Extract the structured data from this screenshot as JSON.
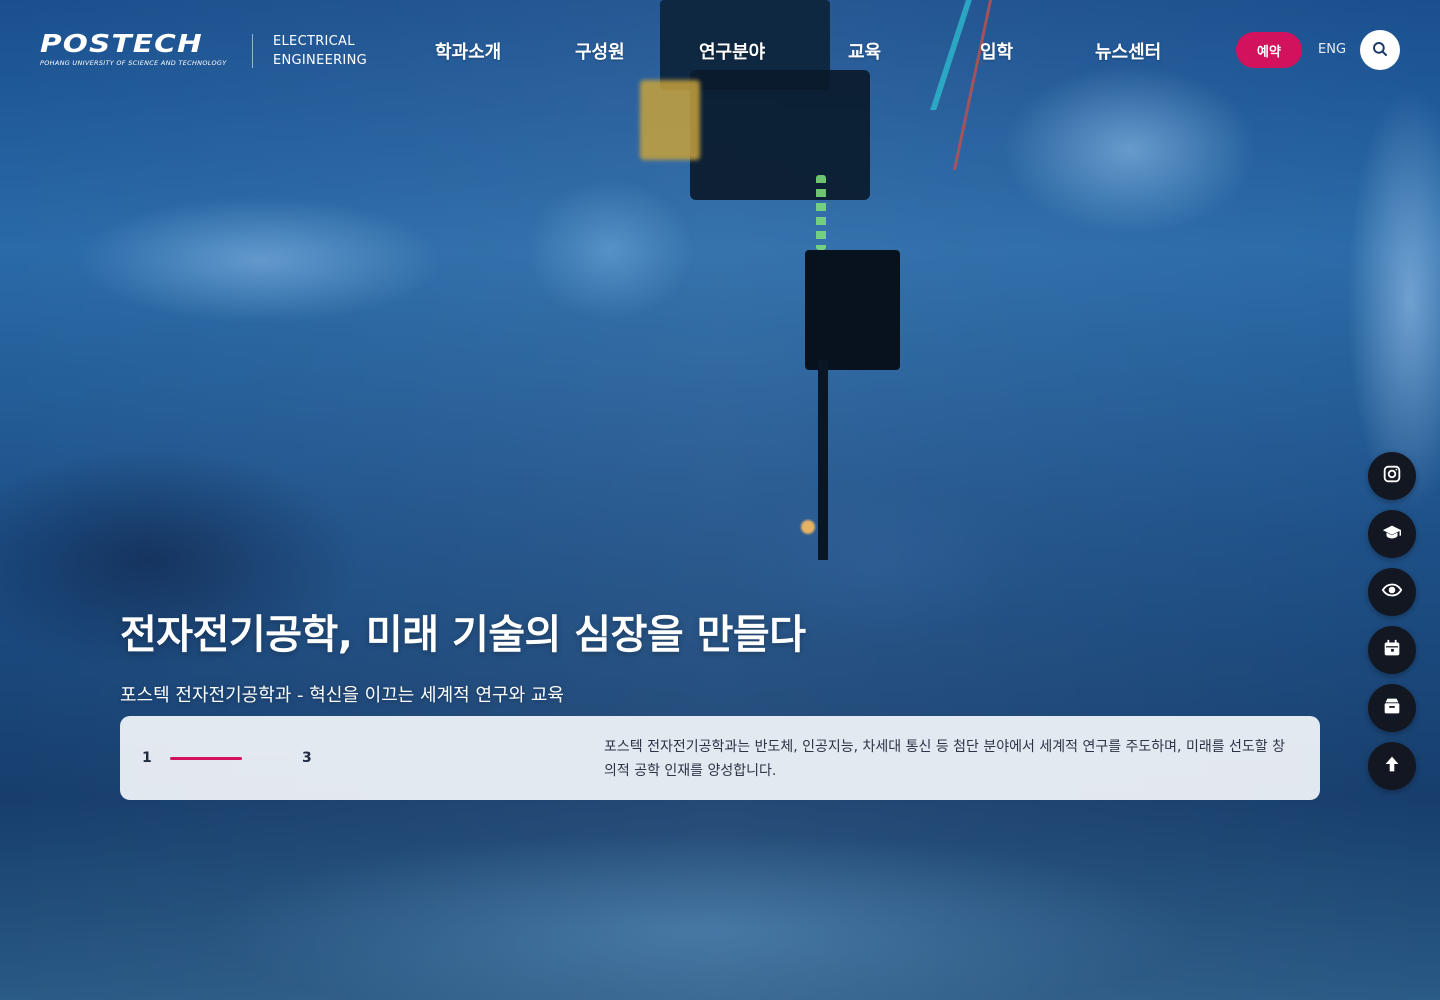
{
  "header": {
    "logo_text": "POSTECH",
    "logo_subtext": "POHANG UNIVERSITY OF SCIENCE AND TECHNOLOGY",
    "department_line1": "ELECTRICAL",
    "department_line2": "ENGINEERING",
    "nav": [
      {
        "label": "학과소개"
      },
      {
        "label": "구성원"
      },
      {
        "label": "연구분야"
      },
      {
        "label": "교육"
      },
      {
        "label": "입학"
      },
      {
        "label": "뉴스센터"
      }
    ],
    "reserve_label": "예약",
    "lang_label": "ENG",
    "search_icon": "search-icon"
  },
  "hero": {
    "headline": "전자전기공학, 미래 기술의 심장을 만들다",
    "subline": "포스텍 전자전기공학과 - 혁신을 이끄는 세계적 연구와 교육"
  },
  "panel": {
    "slide_current": "1",
    "slide_total": "3",
    "progress": 0.6,
    "description": "포스텍 전자전기공학과는 반도체, 인공지능, 차세대 통신 등 첨단 분야에서 세계적 연구를 주도하며, 미래를 선도할 창의적 공학 인재를 양성합니다."
  },
  "quick_menu": [
    {
      "icon": "instagram-icon"
    },
    {
      "icon": "graduation-cap-icon"
    },
    {
      "icon": "eye-icon"
    },
    {
      "icon": "calendar-icon"
    },
    {
      "icon": "archive-icon"
    },
    {
      "icon": "arrow-up-icon"
    }
  ],
  "colors": {
    "accent": "#d3125e",
    "quick_bg": "#131722",
    "panel_bg": "#f2f5fa"
  }
}
